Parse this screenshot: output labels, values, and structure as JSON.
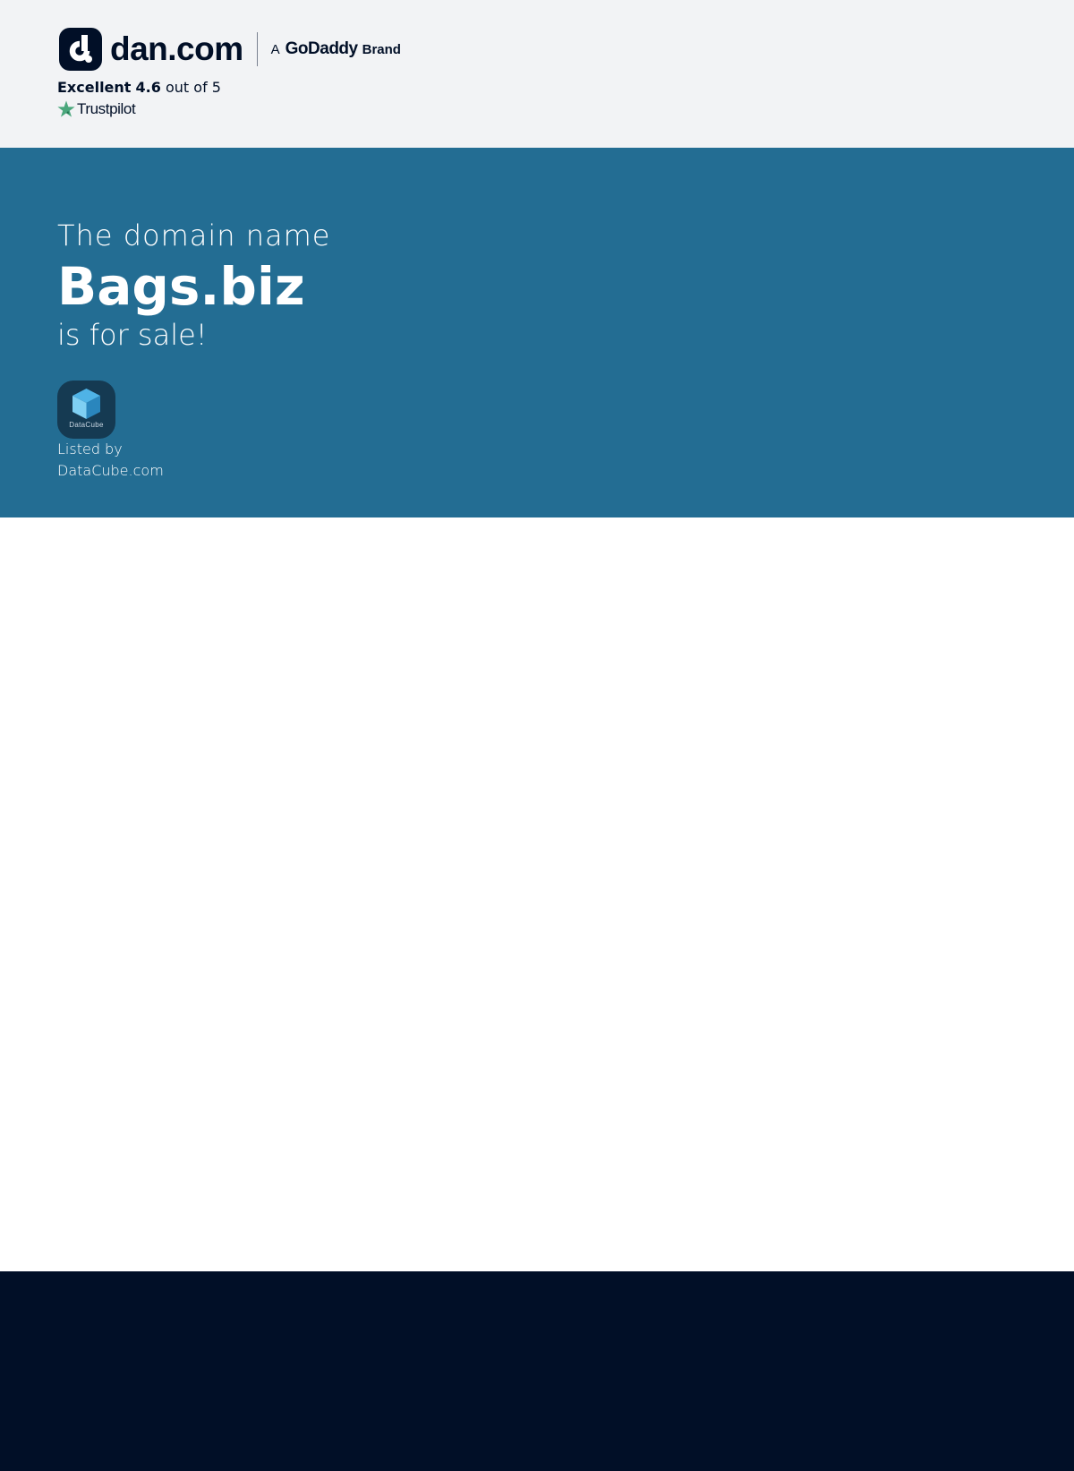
{
  "header": {
    "brand_name": "dan.com",
    "partner_prefix": "A",
    "partner_name": "GoDaddy",
    "partner_suffix": "Brand",
    "rating": {
      "label": "Excellent",
      "score": "4.6",
      "scale_text": "out of 5",
      "source": "Trustpilot"
    }
  },
  "hero": {
    "pre_text": "The domain name",
    "domain": "Bags.biz",
    "post_text": "is for sale!",
    "seller": {
      "logo_text": "DataCube",
      "listed_by_label": "Listed by",
      "name": "DataCube.com"
    }
  },
  "colors": {
    "header_bg": "#f2f3f5",
    "hero_bg": "#236d93",
    "footer_bg": "#010f27",
    "brand_dark": "#010f27",
    "trustpilot_green": "#00b67a"
  },
  "icons": {
    "brand_logo": "dan-logo-icon",
    "trustpilot": "trustpilot-star-icon",
    "seller": "datacube-cube-icon"
  }
}
